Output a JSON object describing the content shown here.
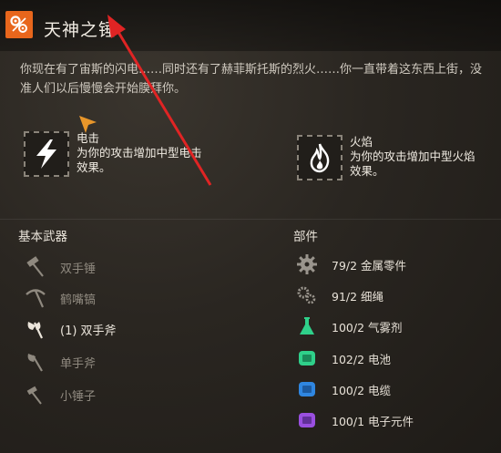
{
  "header": {
    "title": "天神之锤",
    "icon": "hammer-gear-icon",
    "accent": "#e8661c"
  },
  "description": "你现在有了宙斯的闪电……同时还有了赫菲斯托斯的烈火……你一直带着这东西上街，没准人们以后慢慢会开始膜拜你。",
  "effects": [
    {
      "name": "电击",
      "detail": "为你的攻击增加中型电击效果。",
      "icon": "lightning-icon"
    },
    {
      "name": "火焰",
      "detail": "为你的攻击增加中型火焰效果。",
      "icon": "flame-icon"
    }
  ],
  "base_weapons": {
    "title": "基本武器",
    "items": [
      {
        "label": "双手锤",
        "icon": "hammer-icon",
        "active": false
      },
      {
        "label": "鹤嘴镐",
        "icon": "pickaxe-icon",
        "active": false
      },
      {
        "label": "(1) 双手斧",
        "icon": "axe-icon",
        "active": true
      },
      {
        "label": "单手斧",
        "icon": "hatchet-icon",
        "active": false
      },
      {
        "label": "小锤子",
        "icon": "small-hammer-icon",
        "active": false
      }
    ]
  },
  "parts": {
    "title": "部件",
    "items": [
      {
        "label": "79/2 金属零件",
        "icon": "gear-icon",
        "color": "#9a958d"
      },
      {
        "label": "91/2 细绳",
        "icon": "gears-small-icon",
        "color": "#9a958d"
      },
      {
        "label": "100/2 气雾剂",
        "icon": "flask-icon",
        "color": "#2fd08a"
      },
      {
        "label": "102/2 电池",
        "icon": "battery-icon",
        "color": "#2fd08a"
      },
      {
        "label": "100/2 电缆",
        "icon": "cable-icon",
        "color": "#2f86e0"
      },
      {
        "label": "100/1 电子元件",
        "icon": "chip-icon",
        "color": "#9a4fe0"
      }
    ]
  }
}
